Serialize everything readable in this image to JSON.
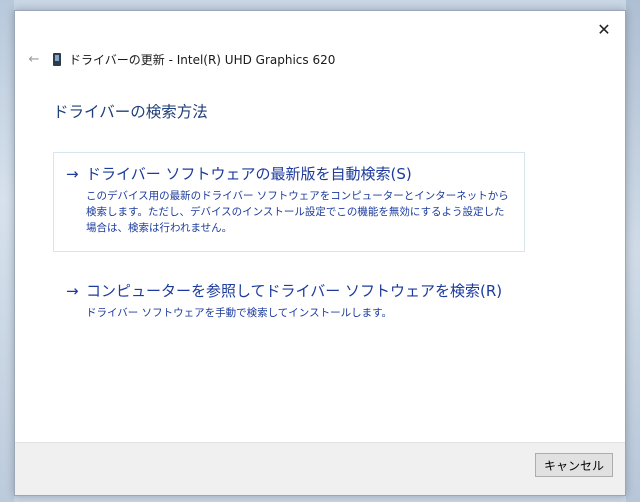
{
  "window": {
    "title": "ドライバーの更新 - Intel(R) UHD Graphics 620",
    "close_glyph": "✕",
    "back_glyph": "←"
  },
  "main": {
    "heading": "ドライバーの検索方法",
    "options": [
      {
        "arrow": "→",
        "title": "ドライバー ソフトウェアの最新版を自動検索(S)",
        "description": "このデバイス用の最新のドライバー ソフトウェアをコンピューターとインターネットから検索します。ただし、デバイスのインストール設定でこの機能を無効にするよう設定した場合は、検索は行われません。"
      },
      {
        "arrow": "→",
        "title": "コンピューターを参照してドライバー ソフトウェアを検索(R)",
        "description": "ドライバー ソフトウェアを手動で検索してインストールします。"
      }
    ]
  },
  "footer": {
    "cancel_label": "キャンセル"
  },
  "icons": {
    "back": "back-arrow-icon",
    "device": "device-icon",
    "close": "close-icon",
    "option_arrow": "arrow-right-icon"
  }
}
